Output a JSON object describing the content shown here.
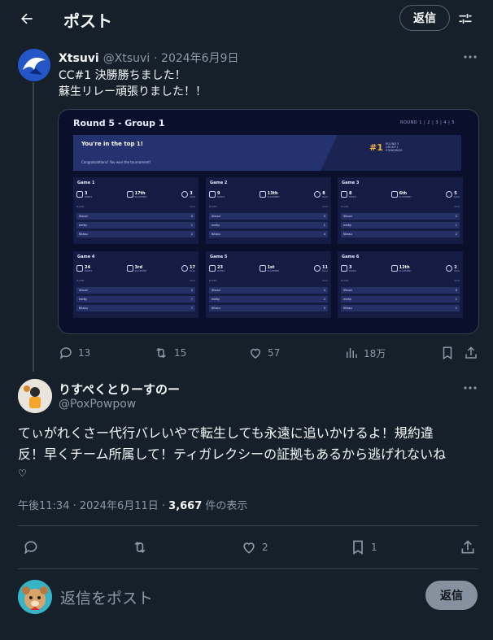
{
  "header": {
    "title": "ポスト",
    "reply_button": "返信"
  },
  "quoted_post": {
    "display_name": "Xtsuvi",
    "handle": "@Xtsuvi",
    "date": "· 2024年6月9日",
    "lines": [
      "CC#1 決勝勝ちました！",
      "蘇生リレー頑張りました！！"
    ],
    "image": {
      "title": "Round 5 - Group 1",
      "round_nav": "ROUND  1  |  2  |  3  |  4  |  5",
      "banner_title": "You're in the top 1!",
      "banner_sub": "Congratulations! You won the tournament!",
      "rank": "#1",
      "rank_sub": [
        "ROUND 5",
        "GROUP 1",
        "STANDINGS"
      ],
      "table_header": [
        "PLAYER",
        "KILLS"
      ],
      "stat_labels": [
        "POINTS",
        "PLACEMENT",
        "KILLS"
      ],
      "games": [
        {
          "title": "Game 1",
          "points": "3",
          "placement": "17th",
          "kills": "3",
          "players": [
            [
              "Xtsuvi",
              "0"
            ],
            [
              "melty",
              "1"
            ],
            [
              "Kitasu",
              "2"
            ]
          ]
        },
        {
          "title": "Game 2",
          "points": "9",
          "placement": "13th",
          "kills": "8",
          "players": [
            [
              "Xtsuvi",
              "3"
            ],
            [
              "melty",
              "1"
            ],
            [
              "Kitasu",
              "4"
            ]
          ]
        },
        {
          "title": "Game 3",
          "points": "8",
          "placement": "6th",
          "kills": "5",
          "players": [
            [
              "Xtsuvi",
              "2"
            ],
            [
              "melty",
              "1"
            ],
            [
              "Kitasu",
              "2"
            ]
          ]
        },
        {
          "title": "Game 4",
          "points": "24",
          "placement": "3rd",
          "kills": "17",
          "players": [
            [
              "Xtsuvi",
              "3"
            ],
            [
              "melty",
              "7"
            ],
            [
              "Kitasu",
              "7"
            ]
          ]
        },
        {
          "title": "Game 5",
          "points": "23",
          "placement": "1st",
          "kills": "11",
          "players": [
            [
              "Xtsuvi",
              "4"
            ],
            [
              "melty",
              "2"
            ],
            [
              "Kitasu",
              "5"
            ]
          ]
        },
        {
          "title": "Game 6",
          "points": "3",
          "placement": "12th",
          "kills": "2",
          "players": [
            [
              "Xtsuvi",
              "0"
            ],
            [
              "melty",
              "1"
            ],
            [
              "Kitasu",
              "1"
            ]
          ]
        }
      ]
    },
    "actions": {
      "replies": "13",
      "reposts": "15",
      "likes": "57",
      "views": "18万"
    }
  },
  "main_post": {
    "display_name": "りすぺくとりーすのー",
    "handle": "@PoxPowpow",
    "lines": [
      "てぃがれくさー代行バレいやで転生しても永遠に追いかけるよ！規約違",
      "反！早くチーム所属して！ティガレクシーの証拠もあるから逃げれないね",
      "♡"
    ],
    "meta_prefix": "午後11:34 · 2024年6月11日 · ",
    "views": "3,667",
    "views_suffix": " 件の表示",
    "actions": {
      "replies": "",
      "reposts": "",
      "likes": "2",
      "bookmarks": "1"
    }
  },
  "composer": {
    "placeholder": "返信をポスト",
    "button": "返信"
  },
  "colors": {
    "background": "#15202b",
    "accent": "#1d9bf0",
    "muted": "#8b98a5",
    "border": "#38444d"
  }
}
